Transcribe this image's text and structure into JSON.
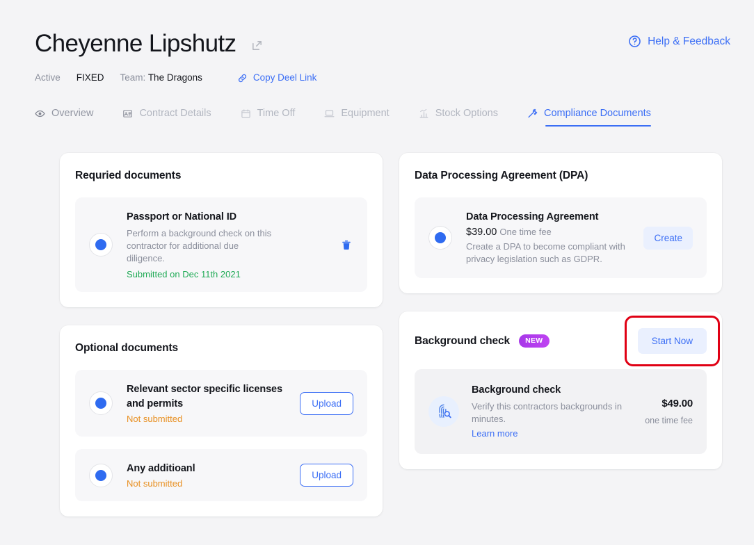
{
  "header": {
    "name": "Cheyenne Lipshutz",
    "edit_icon": "edit-square-icon",
    "help_label": "Help & Feedback",
    "help_icon": "question-circle-icon",
    "status": "Active",
    "contract_type": "FIXED",
    "team_label": "Team:",
    "team_name": "The Dragons",
    "copy_link_label": "Copy Deel Link",
    "copy_link_icon": "link-icon"
  },
  "tabs": [
    {
      "label": "Overview",
      "icon": "eye-icon",
      "active": false
    },
    {
      "label": "Contract Details",
      "icon": "id-card-icon",
      "active": false
    },
    {
      "label": "Time Off",
      "icon": "calendar-icon",
      "active": false
    },
    {
      "label": "Equipment",
      "icon": "laptop-icon",
      "active": false
    },
    {
      "label": "Stock Options",
      "icon": "bar-chart-icon",
      "active": false
    },
    {
      "label": "Compliance Documents",
      "icon": "gavel-icon",
      "active": true
    }
  ],
  "required_documents": {
    "title": "Requried documents",
    "items": [
      {
        "name": "Passport or National ID",
        "description": "Perform a background check on this contractor for additional due diligence.",
        "status": "Submitted on Dec 11th 2021",
        "action_icon": "trash-icon"
      }
    ]
  },
  "dpa": {
    "title": "Data Processing Agreement (DPA)",
    "item": {
      "name": "Data Processing Agreement",
      "price": "$39.00",
      "price_unit": "One time fee",
      "description": "Create a DPA to become compliant with privacy legislation such as GDPR.",
      "button": "Create"
    }
  },
  "optional_documents": {
    "title": "Optional documents",
    "items": [
      {
        "name": "Relevant sector specific licenses and permits",
        "status": "Not submitted",
        "button": "Upload"
      },
      {
        "name": "Any additioanl",
        "status": "Not submitted",
        "button": "Upload"
      }
    ]
  },
  "background_check": {
    "title": "Background check",
    "badge": "NEW",
    "start_button": "Start Now",
    "highlight_color": "#e00014",
    "item": {
      "icon": "fingerprint-search-icon",
      "name": "Background check",
      "description": "Verify this contractors backgrounds in minutes.",
      "link": "Learn more",
      "price": "$49.00",
      "price_unit": "one time fee"
    }
  },
  "colors": {
    "accent": "#3b6ef5",
    "success": "#1faa55",
    "warning": "#e89022",
    "badge": "#b03cec",
    "page_bg": "#f4f4f6"
  }
}
